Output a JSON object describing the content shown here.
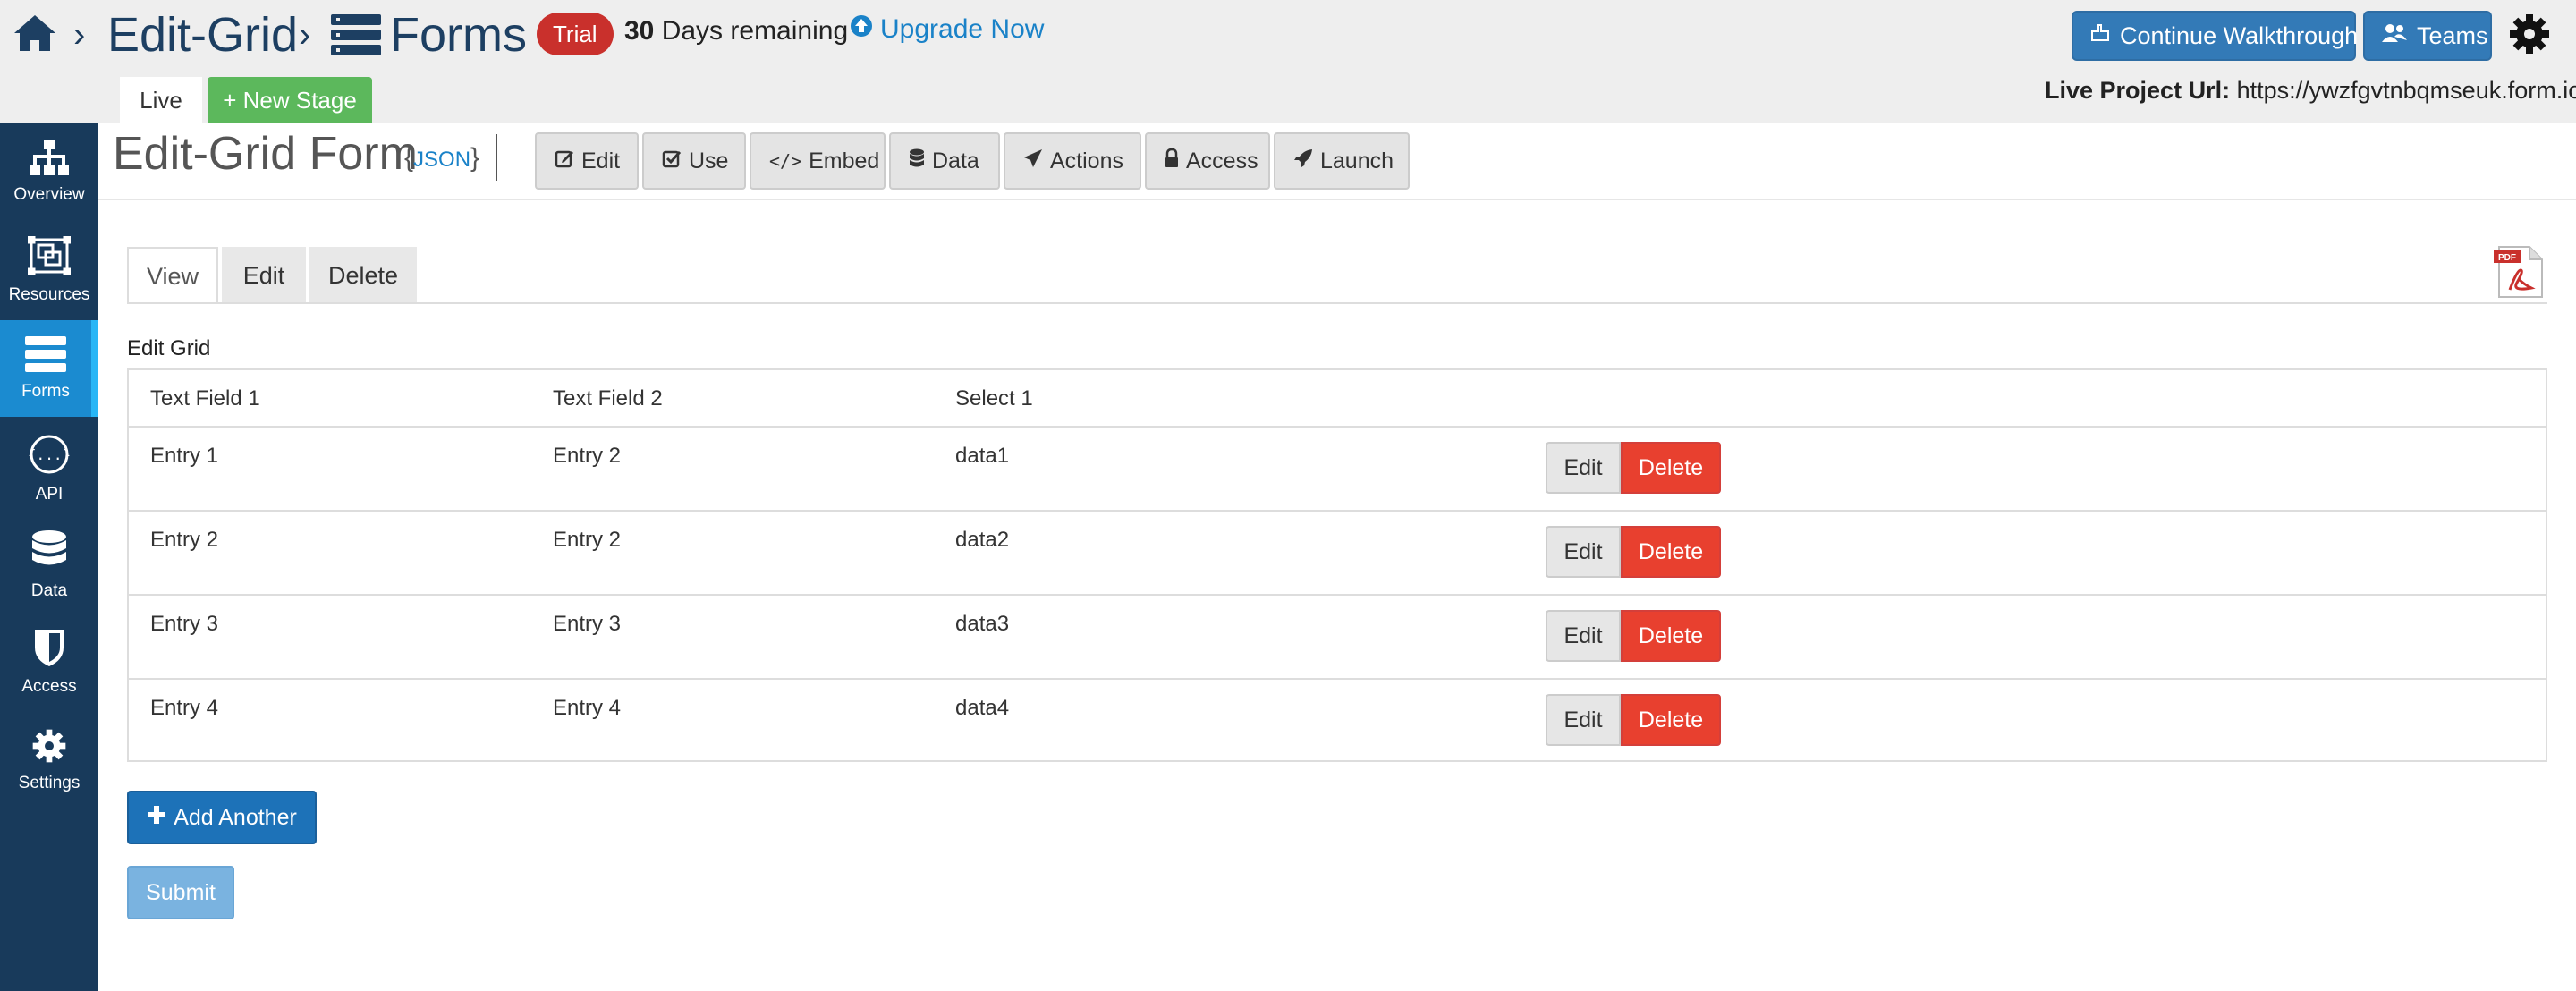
{
  "breadcrumb": {
    "home_icon": "home-icon",
    "separator": "›",
    "project": "Edit-Grid",
    "section": "Forms",
    "section_icon": "forms-icon"
  },
  "trial": {
    "badge": "Trial",
    "days_count": "30",
    "days_text": " Days remaining",
    "upgrade_label": "Upgrade Now"
  },
  "top_buttons": {
    "walkthrough": "Continue Walkthrough",
    "teams": "Teams"
  },
  "stages": {
    "live": "Live",
    "new_stage": "+ New Stage"
  },
  "live_url": {
    "label": "Live Project Url:",
    "value": "https://ywzfgvtnbqmseuk.form.io"
  },
  "sidebar": {
    "items": [
      {
        "label": "Overview",
        "icon": "sitemap-icon",
        "active": false
      },
      {
        "label": "Resources",
        "icon": "resources-icon",
        "active": false
      },
      {
        "label": "Forms",
        "icon": "forms-icon",
        "active": true
      },
      {
        "label": "API",
        "icon": "api-icon",
        "active": false
      },
      {
        "label": "Data",
        "icon": "database-icon",
        "active": false
      },
      {
        "label": "Access",
        "icon": "shield-icon",
        "active": false
      },
      {
        "label": "Settings",
        "icon": "gear-icon",
        "active": false
      }
    ]
  },
  "form_header": {
    "title": "Edit-Grid Form",
    "json_open": "{",
    "json_label": "JSON",
    "json_close": "}",
    "nav": [
      {
        "label": "Edit",
        "icon": "edit-icon"
      },
      {
        "label": "Use",
        "icon": "check-square-icon"
      },
      {
        "label": "Embed",
        "icon": "code-icon"
      },
      {
        "label": "Data",
        "icon": "database-icon"
      },
      {
        "label": "Actions",
        "icon": "paper-plane-icon"
      },
      {
        "label": "Access",
        "icon": "lock-icon"
      },
      {
        "label": "Launch",
        "icon": "rocket-icon"
      }
    ]
  },
  "subtabs": {
    "view": "View",
    "edit": "Edit",
    "delete": "Delete",
    "pdf_icon": "pdf-icon"
  },
  "edit_grid": {
    "label": "Edit Grid",
    "headers": [
      "Text Field 1",
      "Text Field 2",
      "Select 1"
    ],
    "rows": [
      {
        "c1": "Entry 1",
        "c2": "Entry 2",
        "c3": "data1"
      },
      {
        "c1": "Entry 2",
        "c2": "Entry 2",
        "c3": "data2"
      },
      {
        "c1": "Entry 3",
        "c2": "Entry 3",
        "c3": "data3"
      },
      {
        "c1": "Entry 4",
        "c2": "Entry 4",
        "c3": "data4"
      }
    ],
    "edit_label": "Edit",
    "delete_label": "Delete"
  },
  "buttons": {
    "add_another": "Add Another",
    "submit": "Submit"
  },
  "colors": {
    "brand_navy": "#183a5b",
    "sidebar_active": "#1b8bd0",
    "primary": "#337ab7",
    "danger": "#e8402f",
    "success": "#5cb85c",
    "trial": "#c9302c"
  }
}
